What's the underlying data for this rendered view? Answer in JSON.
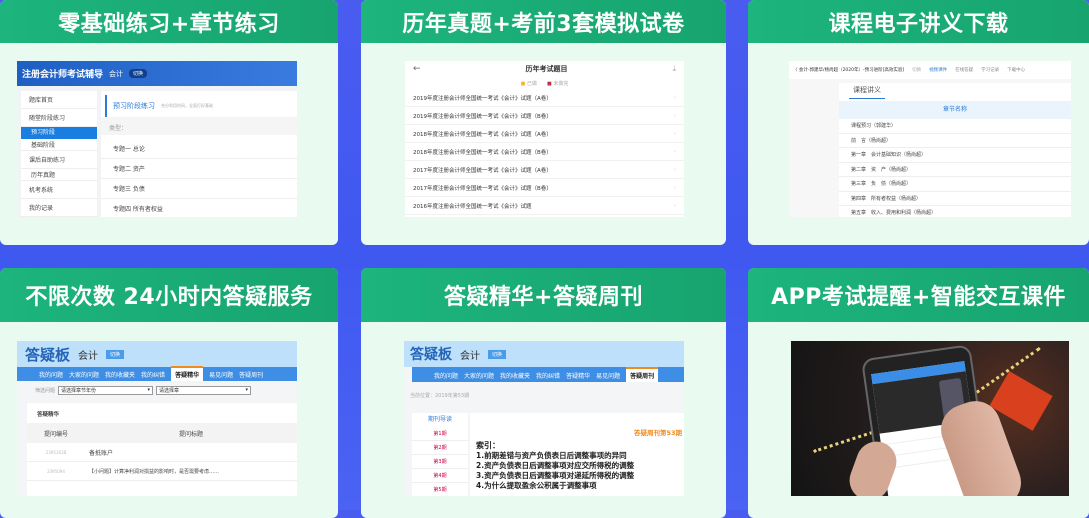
{
  "cards": [
    {
      "title": "零基础练习+章节练习",
      "app": {
        "brand": "注册会计师考试辅导",
        "subject": "会计",
        "switch": "切换",
        "sidebar": [
          "题库首页",
          "随堂阶段练习",
          "预习阶段",
          "基础阶段",
          "课后自助练习",
          "历年真题",
          "机考系统",
          "我的记录"
        ],
        "panel_title": "预习阶段练习",
        "panel_hint": "充分利用时间，全面打好基础",
        "filter_label": "类型：",
        "items": [
          "专题一 总论",
          "专题二 资产",
          "专题三 负债",
          "专题四 所有者权益"
        ]
      }
    },
    {
      "title": "历年真题+考前3套模拟试卷",
      "app": {
        "page_title": "历年考试题目",
        "legend": [
          "已做",
          "未做完"
        ],
        "items": [
          "2019年度注册会计师全国统一考试《会计》试题（A卷）",
          "2019年度注册会计师全国统一考试《会计》试题（B卷）",
          "2018年度注册会计师全国统一考试《会计》试题（A卷）",
          "2018年度注册会计师全国统一考试《会计》试题（B卷）",
          "2017年度注册会计师全国统一考试《会计》试题（A卷）",
          "2017年度注册会计师全国统一考试《会计》试题（B卷）",
          "2016年度注册会计师全国统一考试《会计》试题"
        ]
      }
    },
    {
      "title": "课程电子讲义下载",
      "app": {
        "breadcrumb": "〈 会计-郭建华/杨尚超（2020年）-预习进阶[高效实验]",
        "tabs": [
          "切换",
          "视频课件",
          "在线答疑",
          "学习记录",
          "下载中心"
        ],
        "section": "课程讲义",
        "col_header": "章节名称",
        "items": [
          "课程预习（郭建华）",
          "前　言（杨尚超）",
          "第一章　会计基础知识（杨尚超）",
          "第二章　资　产（杨尚超）",
          "第三章　负　债（杨尚超）",
          "第四章　所有者权益（杨尚超）",
          "第五章　收入、费用和利润（杨尚超）"
        ]
      }
    },
    {
      "title": "不限次数 24小时内答疑服务",
      "app": {
        "brand": "答疑板",
        "subject": "会计",
        "switch": "切换",
        "tabs": [
          "我的问题",
          "大家的问题",
          "我的收藏夹",
          "我的纠错",
          "答疑精华",
          "易见问题",
          "答疑周刊"
        ],
        "filter_label": "筛选问题",
        "select1": "请选择章节年份",
        "select2": "请选择章",
        "section": "答疑精华",
        "col1": "提问编号",
        "col2": "提问标题",
        "rows": [
          [
            "2395161B",
            "备抵账户"
          ],
          [
            "2395094",
            "【小问题】计算净利润对损益的影响时，是否需要考虑……"
          ]
        ]
      }
    },
    {
      "title": "答疑精华+答疑周刊",
      "app": {
        "brand": "答疑板",
        "subject": "会计",
        "switch": "切换",
        "tabs": [
          "我的问题",
          "大家的问题",
          "我的收藏夹",
          "我的纠错",
          "答疑精华",
          "易见问题",
          "答疑周刊"
        ],
        "location": "当前位置：2019年第53期",
        "nav_title": "期刊导读",
        "issues": [
          "第1期",
          "第2期",
          "第3期",
          "第4期",
          "第5期"
        ],
        "issue_title": "答疑周刊第53期",
        "index_label": "索引：",
        "index": [
          "1.前期差错与资产负债表日后调整事项的异同",
          "2.资产负债表日后调整事项对应交所得税的调整",
          "3.资产负债表日后调整事项对递延所得税的调整",
          "4.为什么提取盈余公积属于调整事项"
        ]
      }
    },
    {
      "title": "APP考试提醒+智能交互课件"
    }
  ],
  "colors": {
    "background": "#4a5cf0",
    "header": "#1db47e",
    "card": "#e9fbf1",
    "accent_blue": "#2b7bd8",
    "orange": "#f08c1e"
  }
}
